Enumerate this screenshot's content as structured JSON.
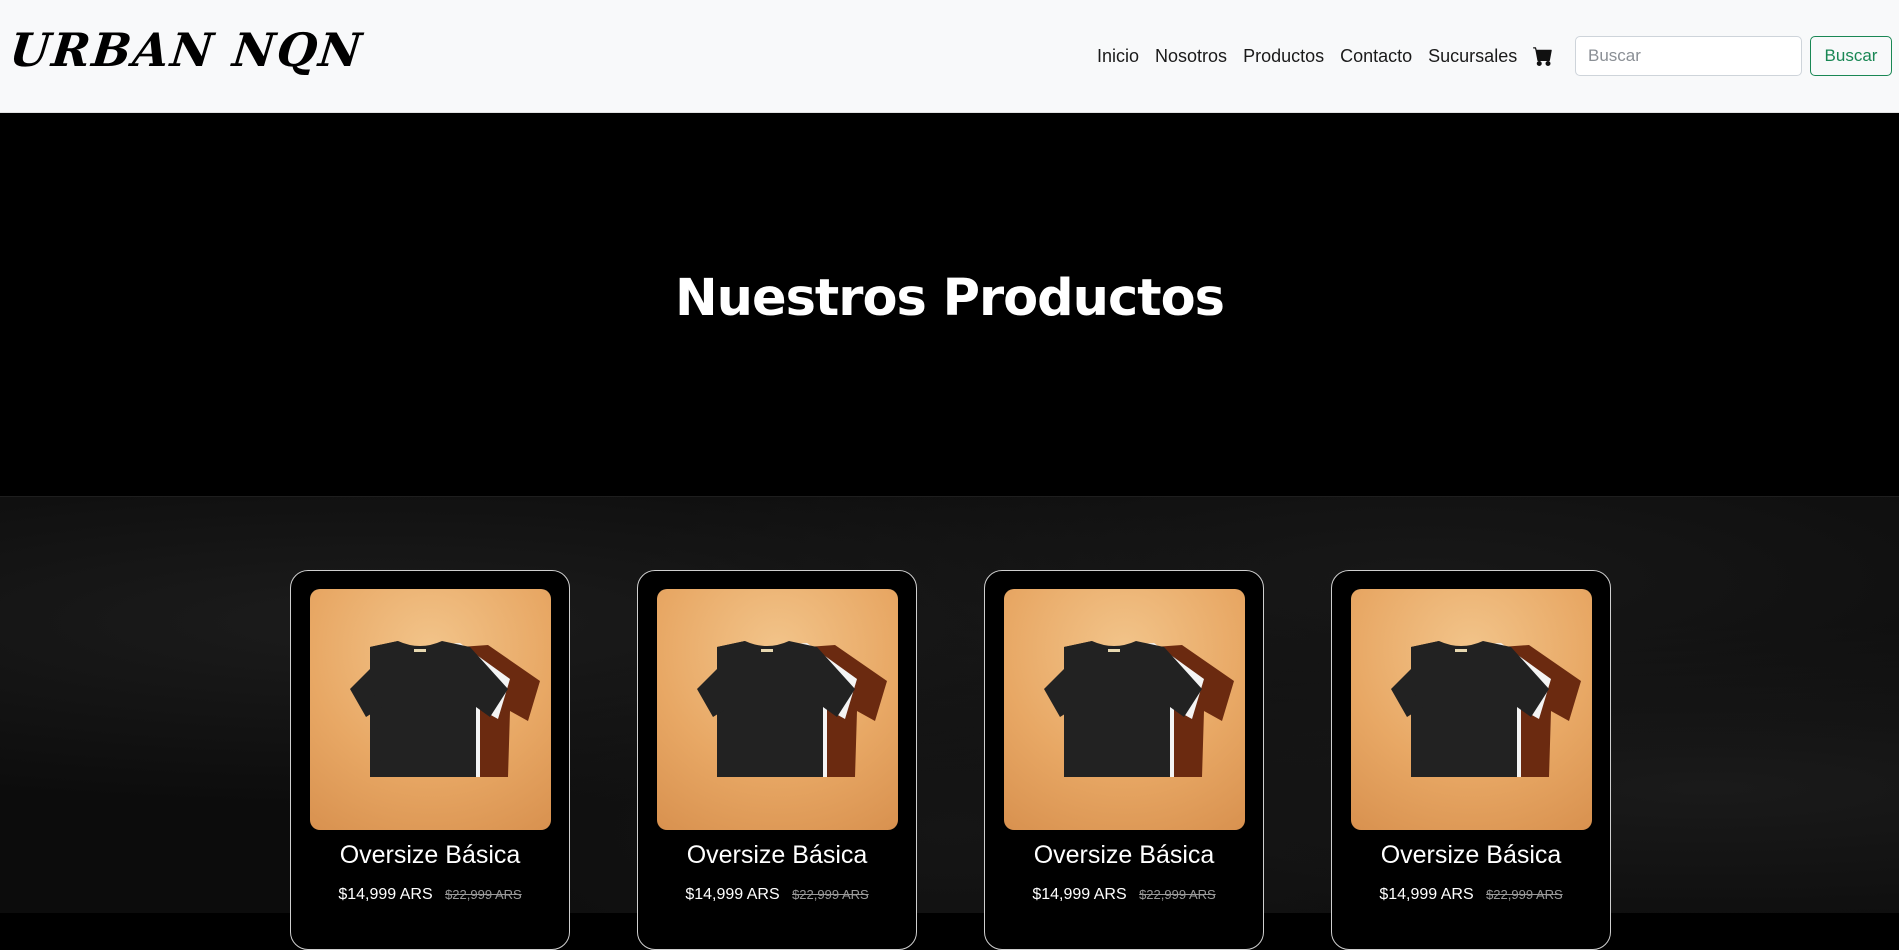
{
  "navbar": {
    "brand": "URBAN NQN",
    "links": [
      "Inicio",
      "Nosotros",
      "Productos",
      "Contacto",
      "Sucursales"
    ],
    "cart_icon": "shopping-cart-icon",
    "search_placeholder": "Buscar",
    "search_button": "Buscar",
    "search_button_color": "#198754"
  },
  "hero": {
    "title": "Nuestros Productos"
  },
  "products": [
    {
      "name": "Oversize Básica",
      "price": "$14,999 ARS",
      "old_price": "$22,999 ARS",
      "image": "tshirts-black-white-brown"
    },
    {
      "name": "Oversize Básica",
      "price": "$14,999 ARS",
      "old_price": "$22,999 ARS",
      "image": "tshirts-black-white-brown"
    },
    {
      "name": "Oversize Básica",
      "price": "$14,999 ARS",
      "old_price": "$22,999 ARS",
      "image": "tshirts-black-white-brown"
    },
    {
      "name": "Oversize Básica",
      "price": "$14,999 ARS",
      "old_price": "$22,999 ARS",
      "image": "tshirts-black-white-brown"
    }
  ]
}
